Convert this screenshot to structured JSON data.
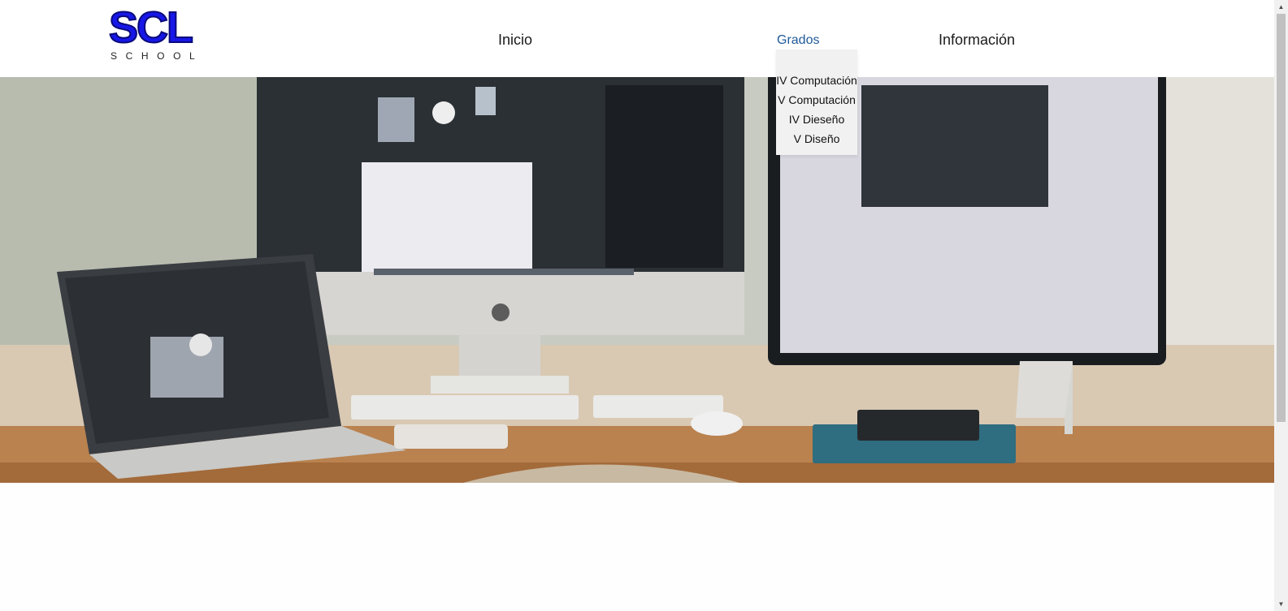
{
  "logo": {
    "main": "SCL",
    "sub": "SCHOOL"
  },
  "nav": {
    "inicio": "Inicio",
    "grados": "Grados",
    "informacion": "Información"
  },
  "dropdown": {
    "items": [
      "IV Computación",
      "V Computación",
      "IV Dieseño",
      "V Diseño"
    ]
  },
  "colors": {
    "logo_blue": "#1717e8",
    "active_link": "#1f5a9a",
    "dropdown_bg": "#f1f1f1"
  },
  "icons": {
    "scroll_up": "scroll-up-arrow-icon",
    "scroll_down": "scroll-down-arrow-icon"
  },
  "hero": {
    "scene": "desk-workstation-photo"
  }
}
